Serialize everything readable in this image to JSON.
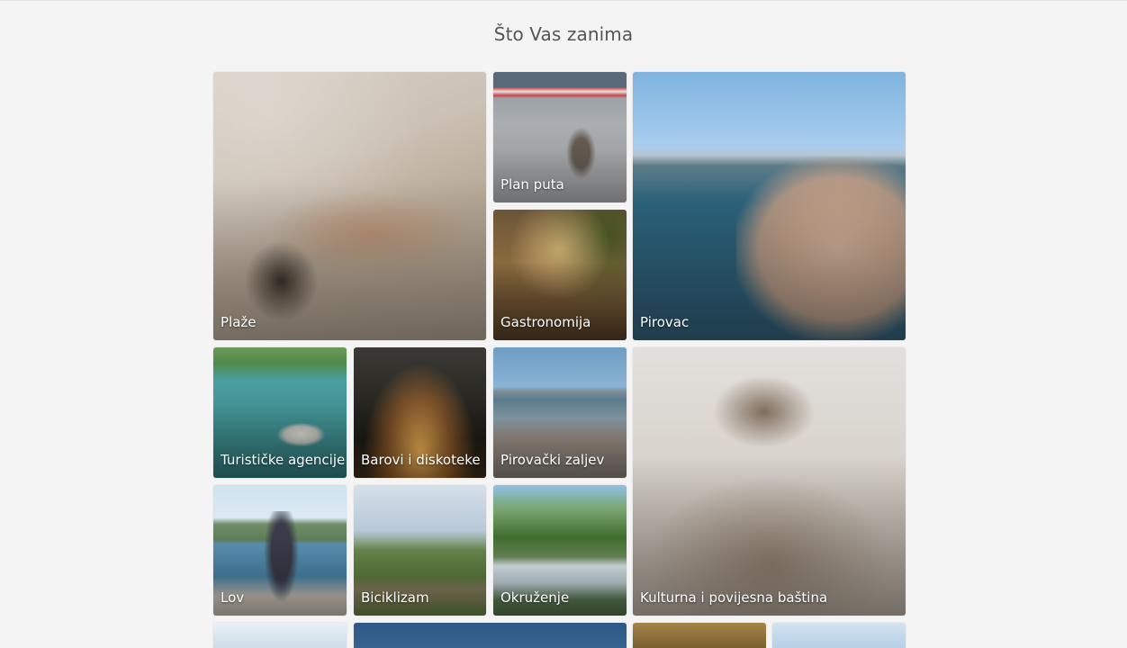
{
  "section": {
    "title": "Što Vas zanima"
  },
  "tiles": [
    {
      "id": "plaze",
      "label": "Plaže"
    },
    {
      "id": "plan-puta",
      "label": "Plan puta"
    },
    {
      "id": "gastronomija",
      "label": "Gastronomija"
    },
    {
      "id": "pirovac",
      "label": "Pirovac"
    },
    {
      "id": "turisticke-agencije",
      "label": "Turističke agencije"
    },
    {
      "id": "barovi-i-diskoteke",
      "label": "Barovi i diskoteke"
    },
    {
      "id": "pirovacki-zaljev",
      "label": "Pirovački zaljev"
    },
    {
      "id": "kulturna-i-povijesna-bastina",
      "label": "Kulturna i povijesna baština"
    },
    {
      "id": "lov",
      "label": "Lov"
    },
    {
      "id": "biciklizam",
      "label": "Biciklizam"
    },
    {
      "id": "okruzenje",
      "label": "Okruženje"
    }
  ]
}
